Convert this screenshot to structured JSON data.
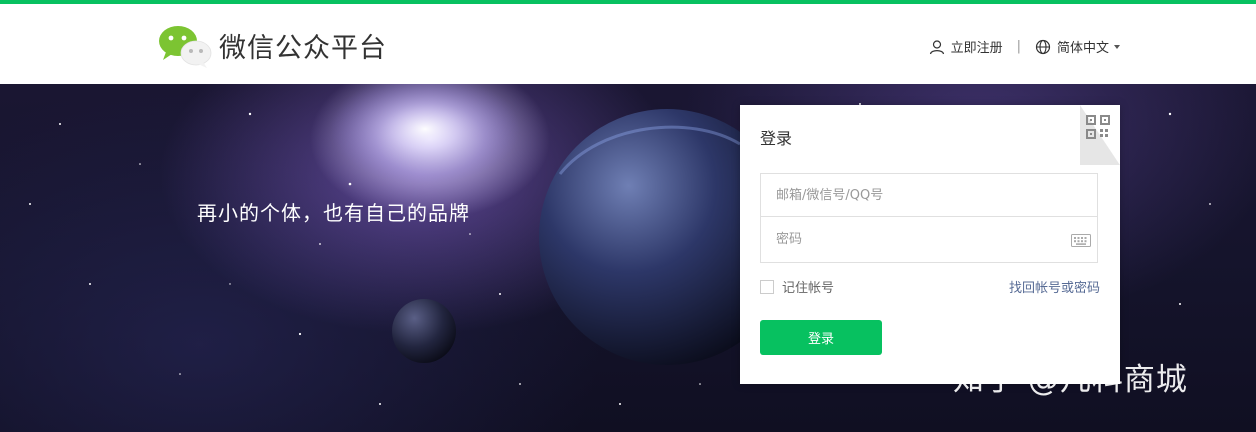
{
  "header": {
    "brand": "微信公众平台",
    "register_label": "立即注册",
    "separator": "|",
    "language_label": "简体中文",
    "icons": {
      "logo": "wechat-logo",
      "register": "user-icon",
      "language": "globe-icon",
      "dropdown": "chevron-down-icon"
    },
    "accent_color": "#07c160"
  },
  "banner": {
    "slogan": "再小的个体，也有自己的品牌"
  },
  "login": {
    "title": "登录",
    "account_placeholder": "邮箱/微信号/QQ号",
    "password_placeholder": "密码",
    "remember_label": "记住帐号",
    "remember_checked": false,
    "forgot_label": "找回帐号或密码",
    "submit_label": "登录",
    "icons": {
      "qr": "qrcode-icon",
      "keyboard": "keyboard-icon"
    }
  },
  "watermark": {
    "text": "知乎 @凡科商城"
  }
}
